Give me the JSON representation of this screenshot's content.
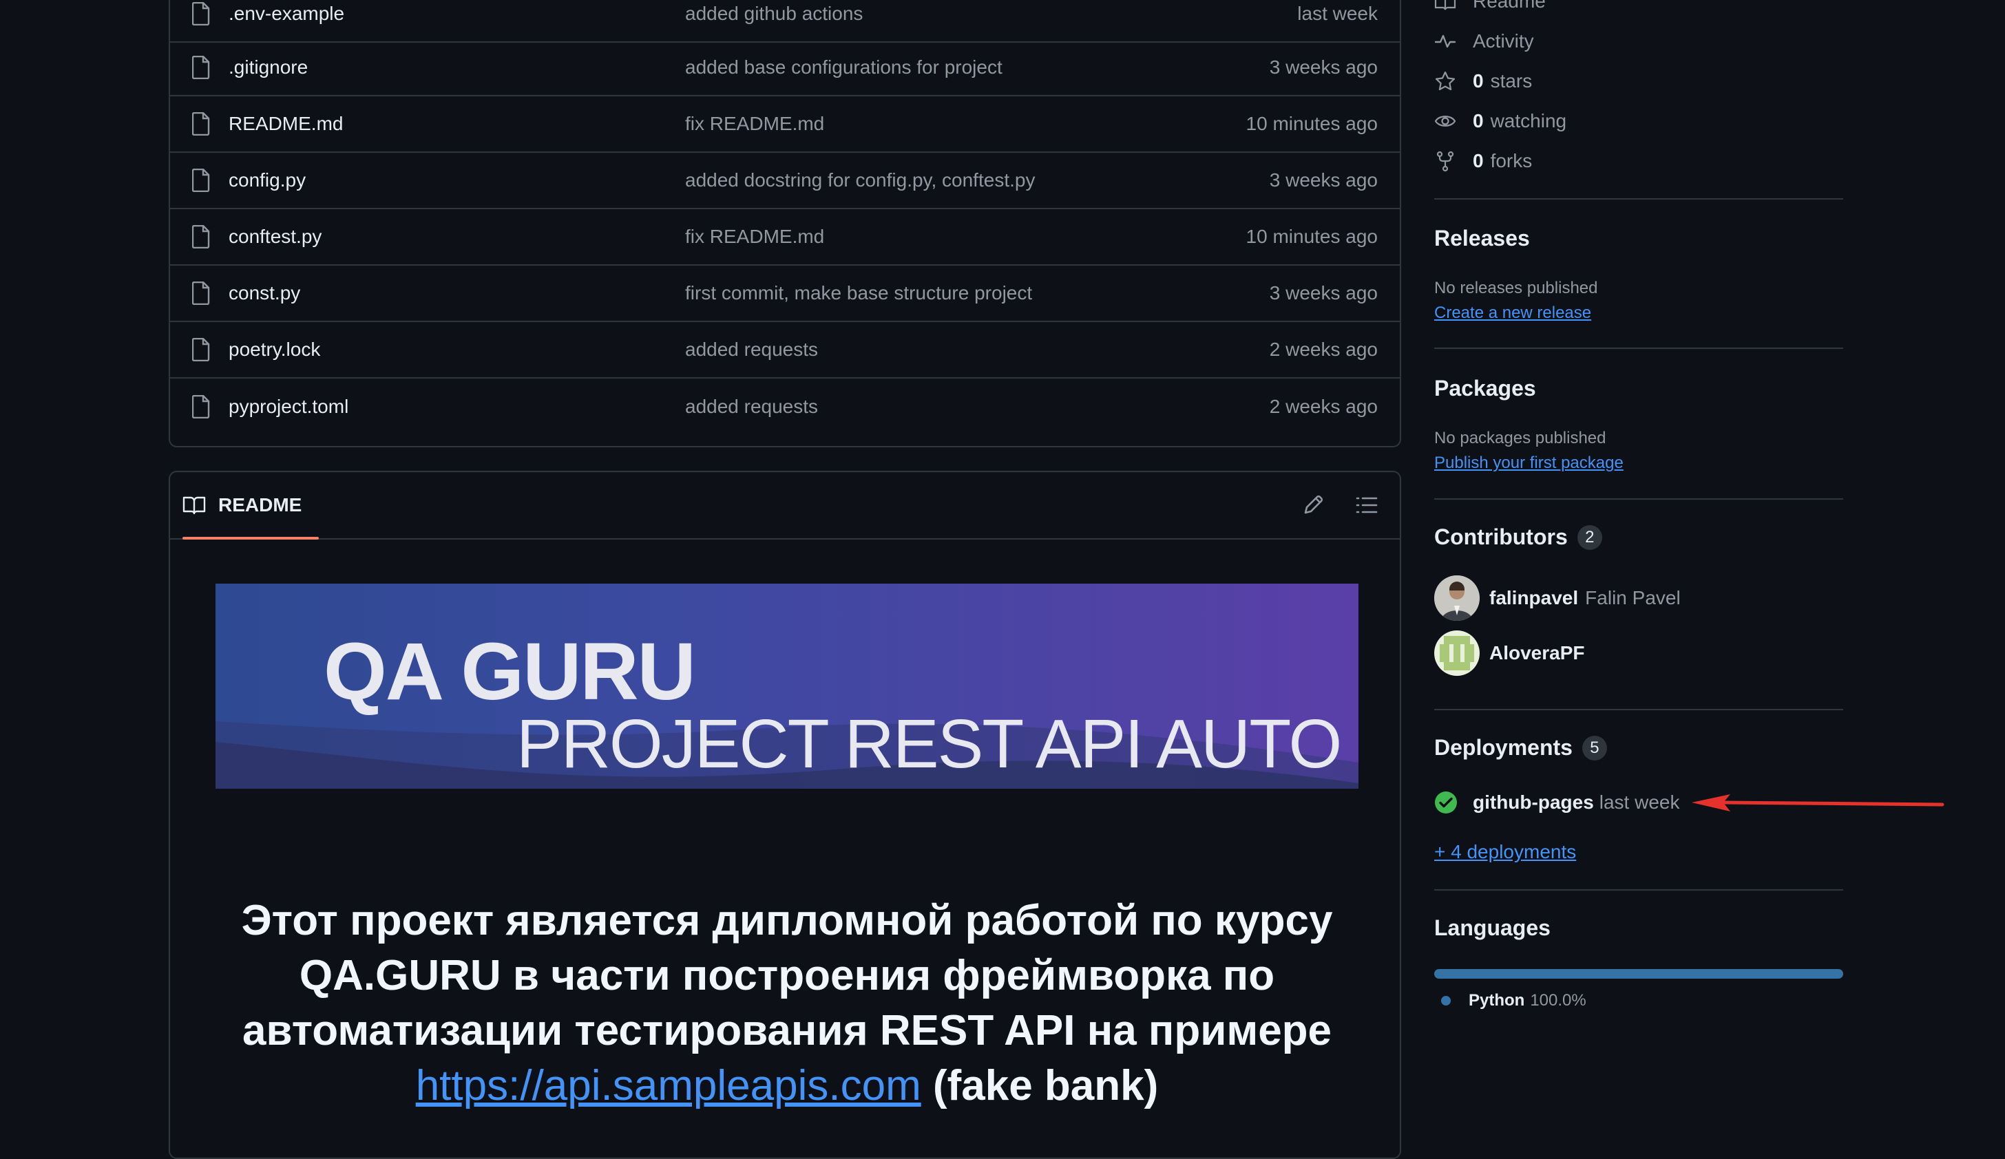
{
  "files": [
    {
      "name": ".env-example",
      "message": "added github actions",
      "age": "last week"
    },
    {
      "name": ".gitignore",
      "message": "added base configurations for project",
      "age": "3 weeks ago"
    },
    {
      "name": "README.md",
      "message": "fix README.md",
      "age": "10 minutes ago"
    },
    {
      "name": "config.py",
      "message": "added docstring for config.py, conftest.py",
      "age": "3 weeks ago"
    },
    {
      "name": "conftest.py",
      "message": "fix README.md",
      "age": "10 minutes ago"
    },
    {
      "name": "const.py",
      "message": "first commit, make base structure project",
      "age": "3 weeks ago"
    },
    {
      "name": "poetry.lock",
      "message": "added requests",
      "age": "2 weeks ago"
    },
    {
      "name": "pyproject.toml",
      "message": "added requests",
      "age": "2 weeks ago"
    }
  ],
  "readme": {
    "tab_label": "README",
    "banner_title": "QA GURU",
    "banner_subtitle": "PROJECT REST API AUTO",
    "heading_line1": "Этот проект является дипломной работой по курсу",
    "heading_line2": "QA.GURU в части построения фреймворка по",
    "heading_line3": "автоматизации тестирования REST API на примере",
    "heading_link": "https://api.sampleapis.com",
    "heading_tail": "(fake bank)"
  },
  "about": {
    "readme_label": "Readme",
    "activity_label": "Activity",
    "stars_count": "0",
    "stars_label": "stars",
    "watching_count": "0",
    "watching_label": "watching",
    "forks_count": "0",
    "forks_label": "forks"
  },
  "releases": {
    "title": "Releases",
    "empty_text": "No releases published",
    "create_link": "Create a new release"
  },
  "packages": {
    "title": "Packages",
    "empty_text": "No packages published",
    "publish_link": "Publish your first package"
  },
  "contributors": {
    "title": "Contributors",
    "count": "2",
    "items": [
      {
        "login": "falinpavel",
        "name": "Falin Pavel"
      },
      {
        "login": "AloveraPF",
        "name": ""
      }
    ]
  },
  "deployments": {
    "title": "Deployments",
    "count": "5",
    "env": "github-pages",
    "time": "last week",
    "more_link": "+ 4 deployments"
  },
  "languages": {
    "title": "Languages",
    "items": [
      {
        "name": "Python",
        "percent": "100.0%",
        "share": 1.0,
        "color": "#3572a5"
      }
    ]
  },
  "colors": {
    "accent": "#f78166",
    "link": "#4493f8",
    "success": "#3fb950",
    "annotation_arrow": "#e5322d"
  }
}
